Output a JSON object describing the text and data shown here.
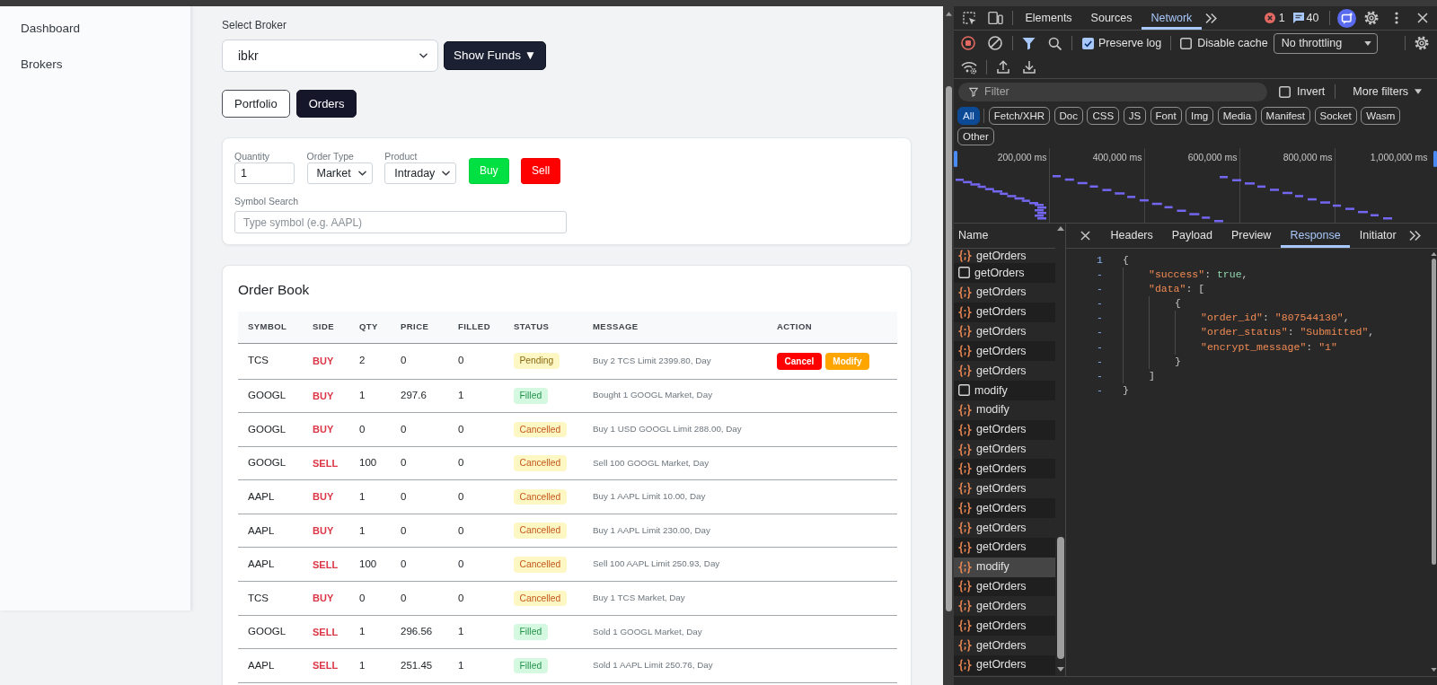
{
  "sidebar": {
    "items": [
      {
        "label": "Dashboard",
        "selected": false
      },
      {
        "label": "Brokers",
        "selected": false
      }
    ]
  },
  "broker_select": {
    "label": "Select Broker",
    "value": "ibkr"
  },
  "funds_button": {
    "label": "Show Funds ▼"
  },
  "view_tabs": [
    {
      "label": "Portfolio",
      "selected": false
    },
    {
      "label": "Orders",
      "selected": true
    }
  ],
  "order_form": {
    "fields": [
      {
        "kind": "input",
        "label": "Quantity",
        "value": "1"
      },
      {
        "kind": "select",
        "label": "Order Type",
        "value": "Market"
      },
      {
        "kind": "select",
        "label": "Product",
        "value": "Intraday"
      }
    ],
    "buttons": [
      {
        "kind": "buy",
        "label": "Buy"
      },
      {
        "kind": "sell",
        "label": "Sell"
      }
    ],
    "symbol_search": {
      "label": "Symbol Search",
      "placeholder": "Type symbol (e.g. AAPL)"
    }
  },
  "order_book": {
    "title": "Order Book",
    "columns": [
      "SYMBOL",
      "SIDE",
      "QTY",
      "PRICE",
      "FILLED",
      "STATUS",
      "MESSAGE",
      "ACTION"
    ],
    "rows": [
      {
        "symbol": "TCS",
        "side": "BUY",
        "qty": "2",
        "price": "0",
        "filled": "0",
        "status": {
          "label": "Pending",
          "kind": "pending"
        },
        "message": "Buy 2 TCS Limit 2399.80, Day",
        "actions": [
          {
            "kind": "cancel",
            "label": "Cancel"
          },
          {
            "kind": "modify",
            "label": "Modify"
          }
        ]
      },
      {
        "symbol": "GOOGL",
        "side": "BUY",
        "qty": "1",
        "price": "297.6",
        "filled": "1",
        "status": {
          "label": "Filled",
          "kind": "filled"
        },
        "message": "Bought 1 GOOGL Market, Day"
      },
      {
        "symbol": "GOOGL",
        "side": "BUY",
        "qty": "0",
        "price": "0",
        "filled": "0",
        "status": {
          "label": "Cancelled",
          "kind": "cancelled"
        },
        "message": "Buy 1 USD GOOGL Limit 288.00, Day"
      },
      {
        "symbol": "GOOGL",
        "side": "SELL",
        "qty": "100",
        "price": "0",
        "filled": "0",
        "status": {
          "label": "Cancelled",
          "kind": "cancelled"
        },
        "message": "Sell 100 GOOGL Market, Day"
      },
      {
        "symbol": "AAPL",
        "side": "BUY",
        "qty": "1",
        "price": "0",
        "filled": "0",
        "status": {
          "label": "Cancelled",
          "kind": "cancelled"
        },
        "message": "Buy 1 AAPL Limit 10.00, Day"
      },
      {
        "symbol": "AAPL",
        "side": "BUY",
        "qty": "1",
        "price": "0",
        "filled": "0",
        "status": {
          "label": "Cancelled",
          "kind": "cancelled"
        },
        "message": "Buy 1 AAPL Limit 230.00, Day"
      },
      {
        "symbol": "AAPL",
        "side": "SELL",
        "qty": "100",
        "price": "0",
        "filled": "0",
        "status": {
          "label": "Cancelled",
          "kind": "cancelled"
        },
        "message": "Sell 100 AAPL Limit 250.93, Day"
      },
      {
        "symbol": "TCS",
        "side": "BUY",
        "qty": "0",
        "price": "0",
        "filled": "0",
        "status": {
          "label": "Cancelled",
          "kind": "cancelled"
        },
        "message": "Buy 1 TCS Market, Day"
      },
      {
        "symbol": "GOOGL",
        "side": "SELL",
        "qty": "1",
        "price": "296.56",
        "filled": "1",
        "status": {
          "label": "Filled",
          "kind": "filled"
        },
        "message": "Sold 1 GOOGL Market, Day"
      },
      {
        "symbol": "AAPL",
        "side": "SELL",
        "qty": "1",
        "price": "251.45",
        "filled": "1",
        "status": {
          "label": "Filled",
          "kind": "filled"
        },
        "message": "Sold 1 AAPL Limit 250.76, Day"
      }
    ]
  },
  "devtools": {
    "panel_tabs": [
      {
        "label": "Elements",
        "selected": false
      },
      {
        "label": "Sources",
        "selected": false
      },
      {
        "label": "Network",
        "selected": true
      }
    ],
    "error_count": "1",
    "message_count": "40",
    "toolbar": {
      "preserve_log": {
        "label": "Preserve log",
        "checked": true
      },
      "disable_cache": {
        "label": "Disable cache",
        "checked": false
      },
      "throttling": "No throttling"
    },
    "filter_bar": {
      "placeholder": "Filter",
      "invert": {
        "label": "Invert",
        "checked": false
      },
      "more_filters": "More filters"
    },
    "type_filters": [
      {
        "label": "All",
        "selected": true
      },
      {
        "label": "Fetch/XHR",
        "selected": false
      },
      {
        "label": "Doc",
        "selected": false
      },
      {
        "label": "CSS",
        "selected": false
      },
      {
        "label": "JS",
        "selected": false
      },
      {
        "label": "Font",
        "selected": false
      },
      {
        "label": "Img",
        "selected": false
      },
      {
        "label": "Media",
        "selected": false
      },
      {
        "label": "Manifest",
        "selected": false
      },
      {
        "label": "Socket",
        "selected": false
      },
      {
        "label": "Wasm",
        "selected": false
      },
      {
        "label": "Other",
        "selected": false
      }
    ],
    "overview": {
      "time_ticks": [
        "200,000 ms",
        "400,000 ms",
        "600,000 ms",
        "800,000 ms",
        "1,000,000 ms"
      ]
    },
    "request_list": {
      "header": "Name",
      "items": [
        {
          "name": "getOrders",
          "kind": "fetch",
          "selected": false
        },
        {
          "name": "getOrders",
          "kind": "document",
          "selected": false
        },
        {
          "name": "getOrders",
          "kind": "fetch",
          "selected": false
        },
        {
          "name": "getOrders",
          "kind": "fetch",
          "selected": false
        },
        {
          "name": "getOrders",
          "kind": "fetch",
          "selected": false
        },
        {
          "name": "getOrders",
          "kind": "fetch",
          "selected": false
        },
        {
          "name": "getOrders",
          "kind": "fetch",
          "selected": false
        },
        {
          "name": "modify",
          "kind": "document",
          "selected": false
        },
        {
          "name": "modify",
          "kind": "fetch",
          "selected": false
        },
        {
          "name": "getOrders",
          "kind": "fetch",
          "selected": false
        },
        {
          "name": "getOrders",
          "kind": "fetch",
          "selected": false
        },
        {
          "name": "getOrders",
          "kind": "fetch",
          "selected": false
        },
        {
          "name": "getOrders",
          "kind": "fetch",
          "selected": false
        },
        {
          "name": "getOrders",
          "kind": "fetch",
          "selected": false
        },
        {
          "name": "getOrders",
          "kind": "fetch",
          "selected": false
        },
        {
          "name": "getOrders",
          "kind": "fetch",
          "selected": false
        },
        {
          "name": "modify",
          "kind": "fetch",
          "selected": true
        },
        {
          "name": "getOrders",
          "kind": "fetch",
          "selected": false
        },
        {
          "name": "getOrders",
          "kind": "fetch",
          "selected": false
        },
        {
          "name": "getOrders",
          "kind": "fetch",
          "selected": false
        },
        {
          "name": "getOrders",
          "kind": "fetch",
          "selected": false
        },
        {
          "name": "getOrders",
          "kind": "fetch",
          "selected": false
        }
      ]
    },
    "detail_tabs": [
      {
        "label": "Headers",
        "selected": false
      },
      {
        "label": "Payload",
        "selected": false
      },
      {
        "label": "Preview",
        "selected": false
      },
      {
        "label": "Response",
        "selected": true
      },
      {
        "label": "Initiator",
        "selected": false
      }
    ],
    "response": {
      "lines": [
        {
          "number": "1",
          "code": "{",
          "children": [
            {
              "number": "-",
              "code": "\"success\": true,"
            },
            {
              "number": "-",
              "code": "\"data\": [",
              "children": [
                {
                  "number": "-",
                  "code": "{",
                  "children": [
                    {
                      "number": "-",
                      "code": "\"order_id\": \"807544130\","
                    },
                    {
                      "number": "-",
                      "code": "\"order_status\": \"Submitted\","
                    },
                    {
                      "number": "-",
                      "code": "\"encrypt_message\": \"1\""
                    }
                  ]
                },
                {
                  "number": "-",
                  "code": "}"
                }
              ]
            },
            {
              "number": "-",
              "code": "]"
            }
          ]
        },
        {
          "number": "-",
          "code": "}"
        }
      ]
    }
  }
}
